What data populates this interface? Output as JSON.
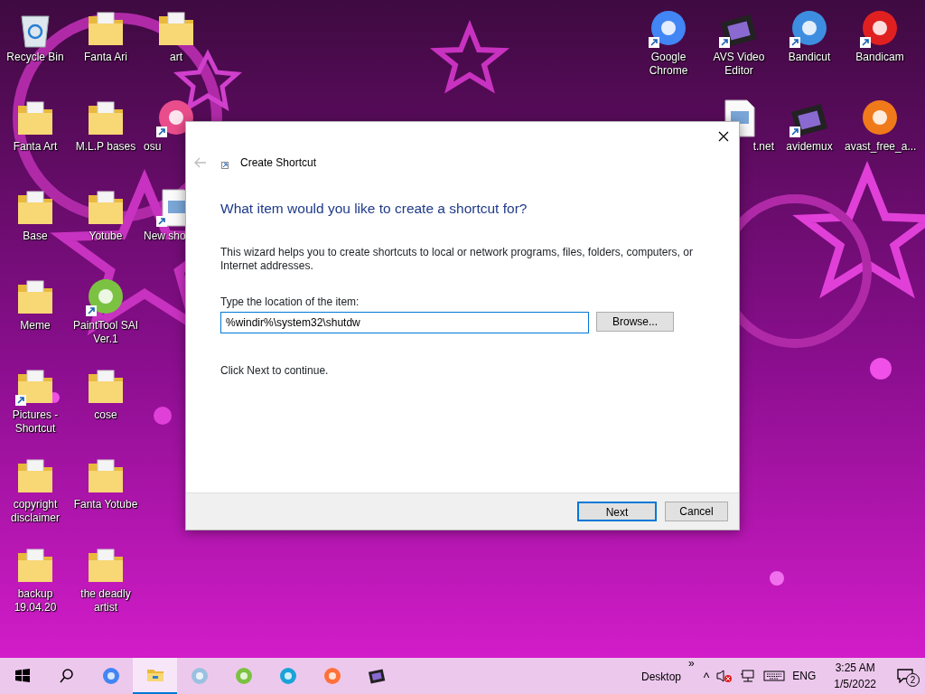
{
  "desktop": {
    "left_columns": [
      [
        {
          "label": "Recycle Bin",
          "kind": "recycle-bin",
          "shortcut": false
        },
        {
          "label": "Fanta Art",
          "kind": "folder",
          "shortcut": false
        },
        {
          "label": "Base",
          "kind": "folder",
          "shortcut": false
        },
        {
          "label": "Meme",
          "kind": "folder",
          "shortcut": false
        },
        {
          "label": "Pictures - Shortcut",
          "kind": "folder",
          "shortcut": true
        },
        {
          "label": "copyright disclaimer",
          "kind": "folder",
          "shortcut": false
        },
        {
          "label": "backup 19.04.20",
          "kind": "folder",
          "shortcut": false
        }
      ],
      [
        {
          "label": "Fanta Ari",
          "kind": "folder",
          "shortcut": false
        },
        {
          "label": "M.L.P bases",
          "kind": "folder",
          "shortcut": false
        },
        {
          "label": "Yotube",
          "kind": "folder",
          "shortcut": false
        },
        {
          "label": "PaintTool SAI Ver.1",
          "kind": "app",
          "color": "#7cc242",
          "shortcut": true
        },
        {
          "label": "cose",
          "kind": "folder",
          "shortcut": false
        },
        {
          "label": "Fanta Yotube",
          "kind": "folder",
          "shortcut": false
        },
        {
          "label": "the deadly artist",
          "kind": "folder",
          "shortcut": false
        }
      ],
      [
        {
          "label": "art",
          "kind": "folder",
          "shortcut": false
        },
        {
          "label": "osu",
          "kind": "app",
          "color": "#e94d8b",
          "shortcut": true
        },
        {
          "label": "New sho",
          "kind": "document",
          "shortcut": true
        }
      ]
    ],
    "right_columns": [
      [
        {
          "label": "Google Chrome",
          "kind": "app",
          "color": "#4285f4",
          "shortcut": true
        }
      ],
      [
        {
          "label": "AVS Video Editor",
          "kind": "film",
          "shortcut": true
        },
        {
          "label": "t.net",
          "kind": "document"
        }
      ],
      [
        {
          "label": "Bandicut",
          "kind": "app",
          "color": "#3d8ee0",
          "shortcut": true
        },
        {
          "label": "avidemux",
          "kind": "film",
          "shortcut": true
        }
      ],
      [
        {
          "label": "Bandicam",
          "kind": "app",
          "color": "#e02020",
          "shortcut": true
        },
        {
          "label": "avast_free_a...",
          "kind": "app",
          "color": "#f07a1a",
          "shortcut": false
        }
      ]
    ]
  },
  "dialog": {
    "title": "Create Shortcut",
    "back_disabled": true,
    "heading": "What item would you like to create a shortcut for?",
    "description": "This wizard helps you to create shortcuts to local or network programs, files, folders, computers, or Internet addresses.",
    "field_label": "Type the location of the item:",
    "location": "%windir%\\system32\\shutdw",
    "browse": "Browse...",
    "hint": "Click Next to continue.",
    "buttons": [
      {
        "label": "Next",
        "default": true
      },
      {
        "label": "Cancel",
        "default": false
      }
    ]
  },
  "taskbar": {
    "items": [
      {
        "kind": "start",
        "selected": false
      },
      {
        "kind": "search",
        "selected": false
      },
      {
        "kind": "app",
        "color": "#4285f4",
        "selected": false
      },
      {
        "kind": "folder",
        "selected": true
      },
      {
        "kind": "app",
        "color": "#9bc1e0",
        "selected": false
      },
      {
        "kind": "app",
        "color": "#7cc242",
        "selected": false
      },
      {
        "kind": "app",
        "color": "#1aa3d9",
        "selected": false
      },
      {
        "kind": "app",
        "color": "#ff7139",
        "selected": false
      },
      {
        "kind": "film",
        "selected": false
      }
    ],
    "toolbar": "Desktop",
    "toolbar_more": "»",
    "tray_up": "^",
    "language": "ENG",
    "time": "3:25 AM",
    "date": "1/5/2022",
    "notifications": "2"
  }
}
